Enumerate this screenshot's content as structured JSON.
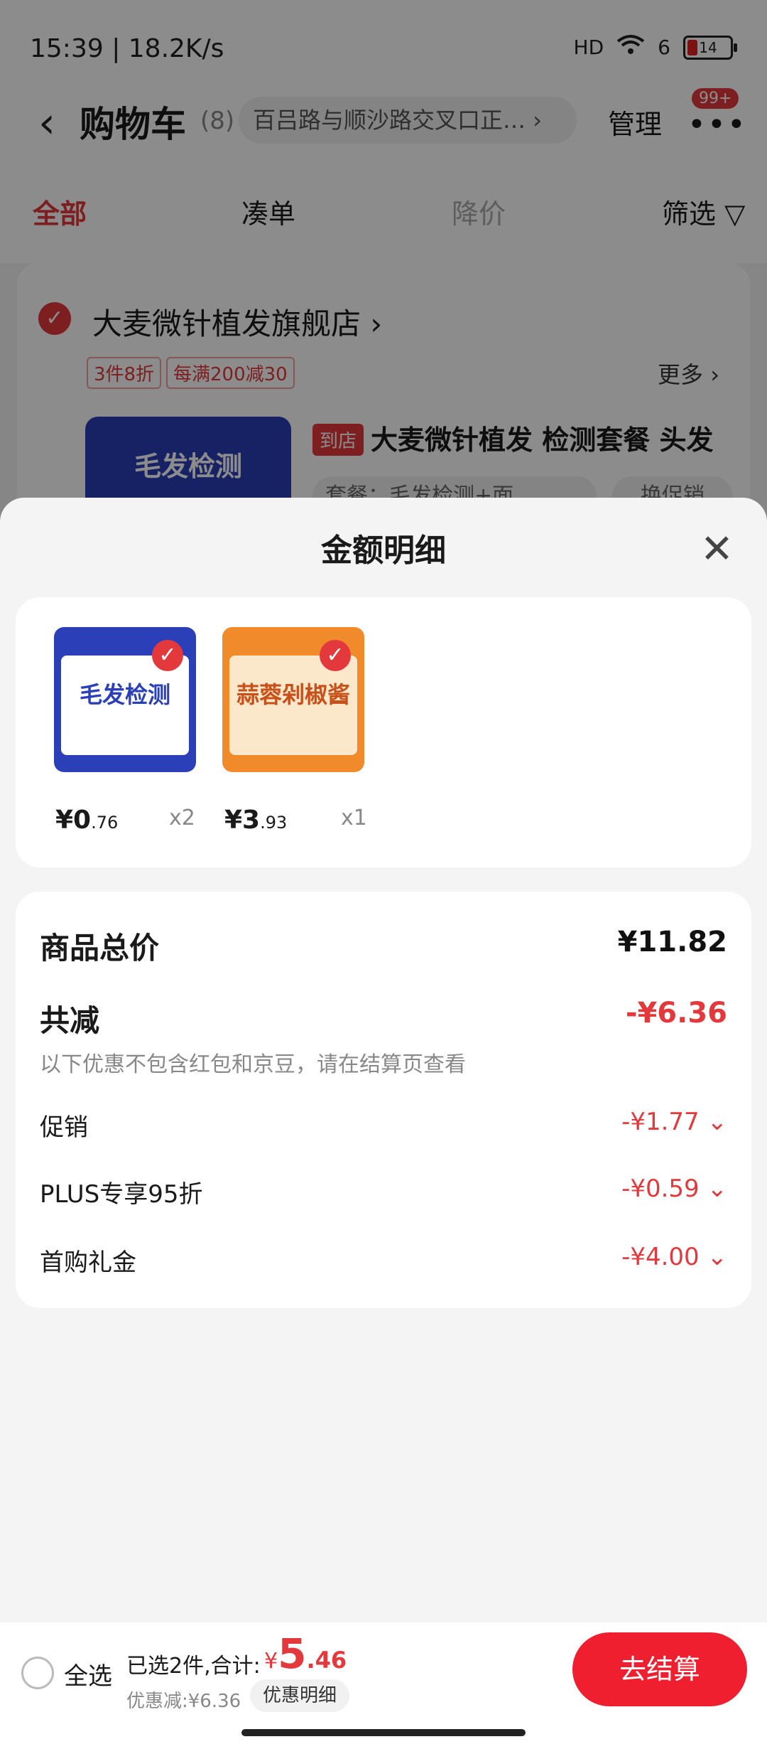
{
  "status_bar": {
    "time": "15:39 | 18.2K/s",
    "signal": "HD",
    "wifi_label": "6",
    "battery": "14"
  },
  "header": {
    "back_icon": "chevron-left-icon",
    "title": "购物车",
    "count": "(8)",
    "address": "百吕路与顺沙路交叉口正…",
    "manage": "管理",
    "badge": "99+"
  },
  "tabs": {
    "all": "全部",
    "bundle": "凑单",
    "price_drop": "降价",
    "filter": "筛选"
  },
  "shop": {
    "name": "大麦微针植发旗舰店",
    "promos": [
      "3件8折",
      "每满200减30"
    ],
    "more": "更多",
    "product_tag": "到店",
    "product_title": "大麦微针植发 检测套餐 头发",
    "product_thumb_text": "毛发检测",
    "product_option": "套餐：毛发检测+面",
    "product_promo_btn": "换促销"
  },
  "sheet": {
    "title": "金额明细",
    "items": [
      {
        "thumb_text": "毛发检测",
        "price_int": "¥0",
        "price_dec": ".76",
        "qty": "x2"
      },
      {
        "thumb_text": "蒜蓉剁椒酱",
        "price_int": "¥3",
        "price_dec": ".93",
        "qty": "x1"
      }
    ],
    "total_label": "商品总价",
    "total_value": "¥11.82",
    "reduce_label": "共减",
    "reduce_value": "-¥6.36",
    "note": "以下优惠不包含红包和京豆，请在结算页查看",
    "rows": [
      {
        "label": "促销",
        "value": "-¥1.77"
      },
      {
        "label": "PLUS专享95折",
        "value": "-¥0.59"
      },
      {
        "label": "首购礼金",
        "value": "-¥4.00"
      }
    ]
  },
  "bottom": {
    "select_all": "全选",
    "selected": "已选2件,合计:",
    "currency": "¥",
    "price_int": "5",
    "price_dec": ".46",
    "discount": "优惠减:¥6.36",
    "detail_btn": "优惠明细",
    "checkout": "去结算"
  }
}
